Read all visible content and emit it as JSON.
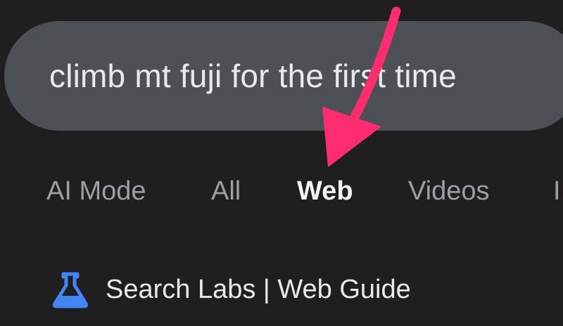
{
  "search": {
    "query": "climb mt fuji for the first time"
  },
  "tabs": [
    {
      "label": "AI Mode",
      "active": false
    },
    {
      "label": "All",
      "active": false
    },
    {
      "label": "Web",
      "active": true
    },
    {
      "label": "Videos",
      "active": false
    },
    {
      "label": "I",
      "active": false
    }
  ],
  "labs_banner": {
    "icon": "flask-icon",
    "text": "Search Labs | Web Guide"
  },
  "annotation": {
    "icon": "pointer-arrow-icon",
    "color": "#ff2d6f"
  },
  "colors": {
    "background": "#1f1f1f",
    "search_bar": "#4d5156",
    "labs_icon": "#4285f4"
  }
}
